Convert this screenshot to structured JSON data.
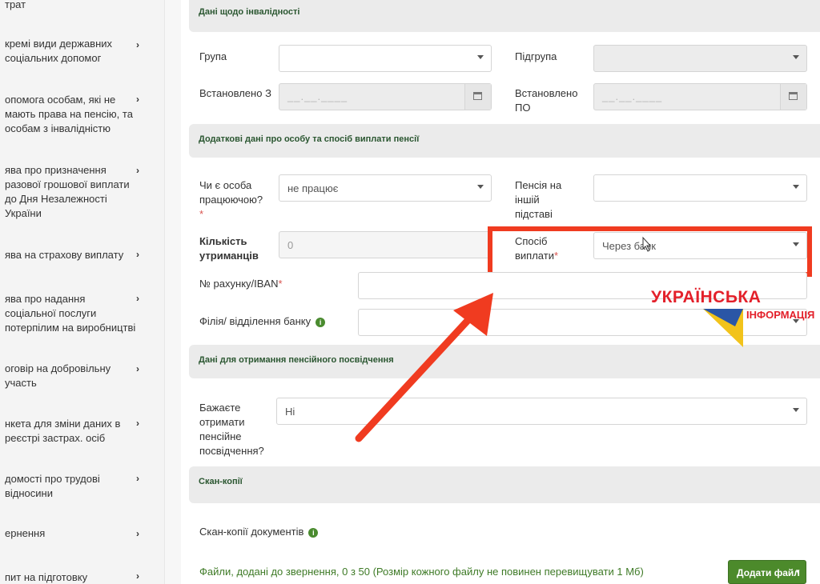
{
  "sidebar": {
    "items": [
      {
        "label": "трат"
      },
      {
        "label": "кремі види державних соціальних допомог"
      },
      {
        "label": "опомога особам, які не мають права на пенсію, та особам з інвалідністю"
      },
      {
        "label": "ява про призначення разової грошової виплати до Дня Незалежності України"
      },
      {
        "label": "ява на страхову виплату"
      },
      {
        "label": "ява про надання соціальної послуги потерпілим на виробництві"
      },
      {
        "label": "оговір на добровільну участь"
      },
      {
        "label": "нкета для зміни даних в реєстрі застрах. осіб"
      },
      {
        "label": "домості про трудові відносини"
      },
      {
        "label": "ернення"
      },
      {
        "label": "пит на підготовку"
      }
    ]
  },
  "sections": {
    "disability": "Дані щодо інвалідності",
    "additional": "Додаткові дані про особу та спосіб виплати пенсії",
    "certificate": "Дані для отримання пенсійного посвідчення",
    "scans": "Скан-копії"
  },
  "form": {
    "group_label": "Група",
    "subgroup_label": "Підгрупа",
    "set_from_label": "Встановлено З",
    "set_to_label": "Встановлено ПО",
    "date_placeholder": "__.__.____",
    "working_label": "Чи є особа працюючою?",
    "working_value": "не працює",
    "other_pension_label": "Пенсія на іншій підставі",
    "dependents_label": "Кількість утриманців",
    "dependents_value": "0",
    "payment_method_label": "Спосіб виплати",
    "payment_method_value": "Через банк",
    "account_label": "№ рахунку/IBAN",
    "bank_branch_label": "Філія/ відділення банку",
    "certificate_label": "Бажаєте отримати пенсійне посвідчення?",
    "certificate_value": "Ні",
    "required_mark": "*"
  },
  "scans": {
    "documents_label": "Скан-копії документів",
    "files_info": "Файли, додані до звернення, 0 з 50 (Розмір кожного файлу не повинен перевищувати 1 Мб)",
    "add_file_button": "Додати файл"
  },
  "watermark": {
    "line1": "УКРАЇНСЬКА",
    "line2": "ІНФОРМАЦІЯ"
  },
  "colors": {
    "accent_green": "#4c8a2b",
    "highlight_red": "#f03b20",
    "required_red": "#d9534f"
  }
}
